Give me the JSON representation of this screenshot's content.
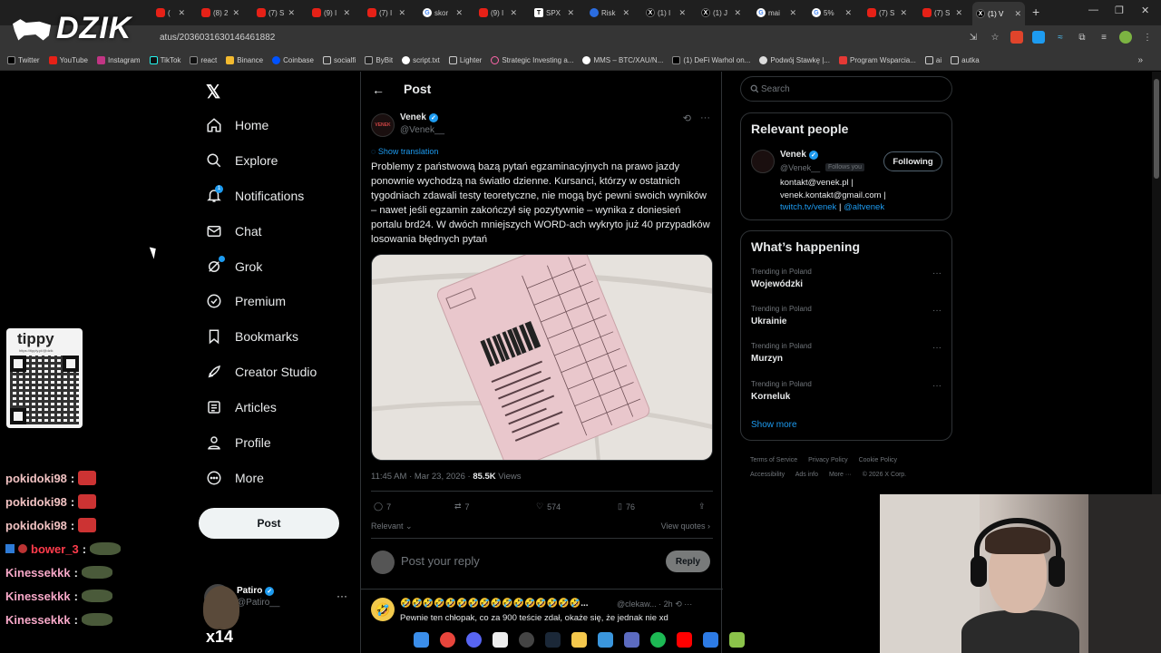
{
  "browser": {
    "tabs": [
      {
        "label": "(",
        "favicon": "youtube-icon"
      },
      {
        "label": "(8) 2",
        "favicon": "youtube-icon"
      },
      {
        "label": "(7) S",
        "favicon": "youtube-icon"
      },
      {
        "label": "(9) I",
        "favicon": "youtube-icon"
      },
      {
        "label": "(7) I",
        "favicon": "youtube-icon"
      },
      {
        "label": "skor",
        "favicon": "google-icon"
      },
      {
        "label": "(9) I",
        "favicon": "youtube-icon"
      },
      {
        "label": "SPX",
        "favicon": "tradingview-icon"
      },
      {
        "label": "Risk",
        "favicon": "bluesky-icon"
      },
      {
        "label": "(1) I",
        "favicon": "x-icon"
      },
      {
        "label": "(1) J",
        "favicon": "x-icon"
      },
      {
        "label": "mai",
        "favicon": "google-icon"
      },
      {
        "label": "5%",
        "favicon": "google-icon"
      },
      {
        "label": "(7) S",
        "favicon": "youtube-icon"
      },
      {
        "label": "(7) S",
        "favicon": "youtube-icon"
      },
      {
        "label": "(1) V",
        "favicon": "x-icon"
      }
    ],
    "url": "atus/2036031630146461882",
    "bookmarks": [
      "Twitter",
      "YouTube",
      "Instagram",
      "TikTok",
      "react",
      "Binance",
      "Coinbase",
      "socialfi",
      "ByBit",
      "script.txt",
      "Lighter",
      "Strategic Investing a...",
      "MMS – BTC/XAU/N...",
      "(1) DeFi Warhol on...",
      "Podwój Stawkę |...",
      "Program Wsparcia...",
      "ai",
      "autka"
    ],
    "bookmarks_more": "»"
  },
  "stream": {
    "logo": "DZIK",
    "tipply_title": "tippy",
    "tipply_url": "https://tipply.pl/@dzik",
    "chat": [
      {
        "user": "pokidoki98",
        "sep": ":"
      },
      {
        "user": "pokidoki98",
        "sep": ":"
      },
      {
        "user": "pokidoki98",
        "sep": ":"
      },
      {
        "user": "bower_3",
        "sep": ":"
      },
      {
        "user": "Kinessekkk",
        "sep": ":"
      },
      {
        "user": "Kinessekkk",
        "sep": ":"
      },
      {
        "user": "Kinessekkk",
        "sep": ":"
      }
    ],
    "overlay_label": "x14"
  },
  "nav": {
    "items": [
      {
        "label": "Home",
        "icon": "home-icon"
      },
      {
        "label": "Explore",
        "icon": "search-icon"
      },
      {
        "label": "Notifications",
        "icon": "bell-icon"
      },
      {
        "label": "Chat",
        "icon": "mail-icon"
      },
      {
        "label": "Grok",
        "icon": "grok-icon"
      },
      {
        "label": "Premium",
        "icon": "verified-icon"
      },
      {
        "label": "Bookmarks",
        "icon": "bookmark-icon"
      },
      {
        "label": "Creator Studio",
        "icon": "rocket-icon"
      },
      {
        "label": "Articles",
        "icon": "article-icon"
      },
      {
        "label": "Profile",
        "icon": "person-icon"
      },
      {
        "label": "More",
        "icon": "more-circle-icon"
      }
    ],
    "notification_badge": "1",
    "post_button": "Post",
    "account": {
      "name": "Patiro",
      "handle": "@Patiro__",
      "more": "···"
    }
  },
  "post": {
    "header": "Post",
    "author_name": "Venek",
    "author_handle": "@Venek__",
    "avatar_text": "VENEK",
    "show_translation": "Show translation",
    "text": "Problemy z państwową bazą pytań egzaminacyjnych na prawo jazdy ponownie wychodzą na światło dzienne. Kursanci, którzy w ostatnich tygodniach zdawali testy teoretyczne, nie mogą być pewni swoich wyników – nawet jeśli egzamin zakończył się pozytywnie – wynika z doniesień portalu brd24. W dwóch mniejszych WORD-ach wykryto już 40 przypadków losowania błędnych pytań",
    "timestamp": "11:45 AM · Mar 23, 2026 · ",
    "views": "85.5K",
    "views_label": " Views",
    "replies": "7",
    "reposts": "7",
    "likes": "574",
    "bookmarks": "76",
    "sort_label": "Relevant",
    "view_quotes": "View quotes",
    "reply_placeholder": "Post your reply",
    "reply_button": "Reply",
    "first_reply": {
      "name": "🤣🤣🤣🤣🤣🤣🤣🤣🤣🤣🤣🤣🤣🤣🤣🤣...",
      "handle": "@clekaw... · 2h",
      "text": "Pewnie ten chłopak, co za 900 teście zdał, okaże się, że jednak nie xd"
    }
  },
  "sidebar": {
    "search_placeholder": "Search",
    "relevant_title": "Relevant people",
    "person": {
      "name": "Venek",
      "handle": "@Venek__",
      "follows_you": "Follows you",
      "button": "Following",
      "bio_1": "kontakt@venek.pl |",
      "bio_2": "venek.kontakt@gmail.com |",
      "bio_link_1": "twitch.tv/venek",
      "bio_sep": " | ",
      "bio_link_2": "@altvenek"
    },
    "happening_title": "What’s happening",
    "trends": [
      {
        "label": "Trending in Poland",
        "name": "Wojewódzki"
      },
      {
        "label": "Trending in Poland",
        "name": "Ukrainie"
      },
      {
        "label": "Trending in Poland",
        "name": "Murzyn"
      },
      {
        "label": "Trending in Poland",
        "name": "Korneluk"
      }
    ],
    "show_more": "Show more",
    "footer": [
      "Terms of Service",
      "Privacy Policy",
      "Cookie Policy",
      "Accessibility",
      "Ads info",
      "More ···",
      "© 2026 X Corp."
    ]
  }
}
